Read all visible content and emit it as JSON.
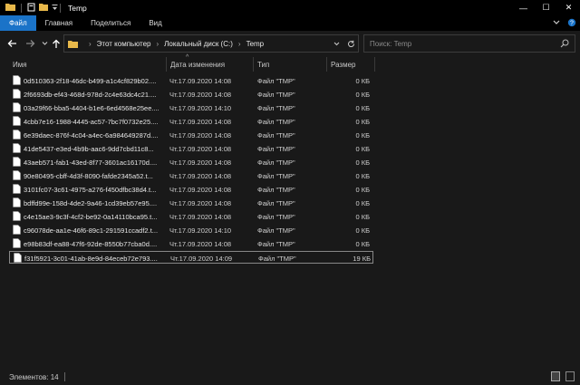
{
  "window": {
    "title": "Temp",
    "minimize": "—",
    "maximize": "☐",
    "close": "✕"
  },
  "ribbon": {
    "tabs": [
      "Файл",
      "Главная",
      "Поделиться",
      "Вид"
    ],
    "active_index": 0
  },
  "address": {
    "breadcrumbs": [
      "Этот компьютер",
      "Локальный диск (C:)",
      "Temp"
    ]
  },
  "search": {
    "placeholder": "Поиск: Temp"
  },
  "columns": {
    "name": "Имя",
    "date": "Дата изменения",
    "type": "Тип",
    "size": "Размер"
  },
  "files": [
    {
      "name": "0d510363-2f18-46dc-b499-a1c4cf829b02....",
      "date": "Чт.17.09.2020 14:08",
      "type": "Файл \"TMP\"",
      "size": "0 КБ"
    },
    {
      "name": "2f6693db-ef43-468d-978d-2c4e63dc4c21....",
      "date": "Чт.17.09.2020 14:08",
      "type": "Файл \"TMP\"",
      "size": "0 КБ"
    },
    {
      "name": "03a29f66-bba5-4404-b1e6-6ed4568e25ee....",
      "date": "Чт.17.09.2020 14:10",
      "type": "Файл \"TMP\"",
      "size": "0 КБ"
    },
    {
      "name": "4cbb7e16-1988-4445-ac57-7bc7f0732e25....",
      "date": "Чт.17.09.2020 14:08",
      "type": "Файл \"TMP\"",
      "size": "0 КБ"
    },
    {
      "name": "6e39daec-876f-4c04-a4ec-6a984649287d....",
      "date": "Чт.17.09.2020 14:08",
      "type": "Файл \"TMP\"",
      "size": "0 КБ"
    },
    {
      "name": "41de5437-e3ed-4b9b-aac6-9dd7cbd11c8...",
      "date": "Чт.17.09.2020 14:08",
      "type": "Файл \"TMP\"",
      "size": "0 КБ"
    },
    {
      "name": "43aeb571-fab1-43ed-8f77-3601ac16170d....",
      "date": "Чт.17.09.2020 14:08",
      "type": "Файл \"TMP\"",
      "size": "0 КБ"
    },
    {
      "name": "90e80495-cbff-4d3f-8090-fafde2345a52.t...",
      "date": "Чт.17.09.2020 14:08",
      "type": "Файл \"TMP\"",
      "size": "0 КБ"
    },
    {
      "name": "3101fc07-3c61-4975-a276-f450dfbc38d4.t...",
      "date": "Чт.17.09.2020 14:08",
      "type": "Файл \"TMP\"",
      "size": "0 КБ"
    },
    {
      "name": "bdffd99e-158d-4de2-9a46-1cd39eb57e95....",
      "date": "Чт.17.09.2020 14:08",
      "type": "Файл \"TMP\"",
      "size": "0 КБ"
    },
    {
      "name": "c4e15ae3-9c3f-4cf2-be92-0a14110bca95.t...",
      "date": "Чт.17.09.2020 14:08",
      "type": "Файл \"TMP\"",
      "size": "0 КБ"
    },
    {
      "name": "c96078de-aa1e-46f6-89c1-291591ccadf2.t...",
      "date": "Чт.17.09.2020 14:10",
      "type": "Файл \"TMP\"",
      "size": "0 КБ"
    },
    {
      "name": "e98b83df-ea88-47f6-92de-8550b77cba0d....",
      "date": "Чт.17.09.2020 14:08",
      "type": "Файл \"TMP\"",
      "size": "0 КБ"
    },
    {
      "name": "f31f5921-3c01-41ab-8e9d-84eceb72e793....",
      "date": "Чт.17.09.2020 14:09",
      "type": "Файл \"TMP\"",
      "size": "19 КБ"
    }
  ],
  "status": {
    "item_count": "Элементов: 14"
  },
  "colors": {
    "accent": "#1a73c8",
    "background": "#191919",
    "titlebar": "#000000",
    "folder": "#e8b84a"
  }
}
